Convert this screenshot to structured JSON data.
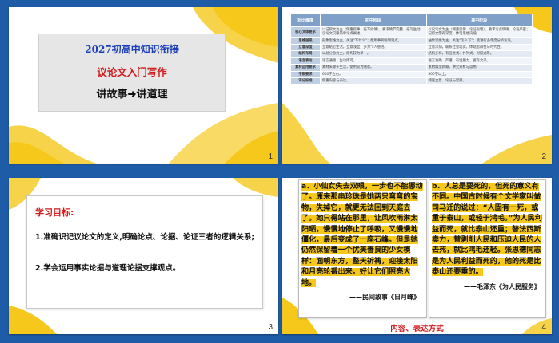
{
  "slide1": {
    "number": "1",
    "line1": "2027初高中知识衔接",
    "line2": "议论文入门写作",
    "line3": "讲故事➜讲道理"
  },
  "slide2": {
    "number": "2",
    "headers": [
      "对比维度",
      "初中阶段",
      "高中阶段"
    ],
    "rows": [
      {
        "label": "核心文体要求",
        "a": "以记叙文为主（侧重叙事、描写抒情），要求情节完整、描写生动，议论文仅限简单论点阐述。",
        "b": "以议论文为主（侧重思辨、论证说理），要求论点明确、论证严密；记叙文需有深度、体现思想内涵。"
      },
      {
        "label": "思维层级",
        "a": "形象思维为主，关注“写什么”；能用事例说明观点。",
        "b": "抽象思维为主，关注“怎么写”；能进行多角度分析论证。"
      },
      {
        "label": "立意深度",
        "a": "立意贴近生活，立意浅显，多为个人感悟。",
        "b": "立意深刻，联系社会现实，体现思辨性与时代性。"
      },
      {
        "label": "结构布局",
        "a": "以总分总为主，结构较为单一。",
        "b": "结构多样，有层进式、并列式、对照式等。"
      },
      {
        "label": "语言表达",
        "a": "语言通顺、生动即可。",
        "b": "语言准确、严谨、有说服力，富有文采。"
      },
      {
        "label": "素材运用要求",
        "a": "素材来源于生活，使用较为随意。",
        "b": "素材典型新颖，讲究分析与运用。"
      },
      {
        "label": "字数要求",
        "a": "600字左右。",
        "b": "800字以上。"
      },
      {
        "label": "评分标准",
        "a": "侧重内容与表达。",
        "b": "侧重立意、论证与思辨。"
      }
    ]
  },
  "slide3": {
    "number": "3",
    "title": "学习目标:",
    "point1": "1.准确识记议论文的定义,明确论点、论据、论证三者的逻辑关系;",
    "point2": "2.学会运用事实论据与道理论据支撑观点。"
  },
  "slide4": {
    "number": "4",
    "left_text_plain": "a．小仙女失去双眼，一步也不能挪动了。原来那串珍珠是她两只弯弯的宝物，失掉它，就更无法回到天庭去了。她只得站在那里，让风吹雨淋太阳晒，慢慢地停止了呼吸，又慢慢地僵化，最后变成了一座石峰。但是她仍然保留着一个优美善良的少女模样：面朝东方，整天祈祷，迎接太阳和月亮轮番出来，好让它们照亮大地。",
    "left_cite": "——民间故事《日月峰》",
    "right_text": "b．人总是要死的，但死的意义有不同。中国古时候有个文学家叫做司马迁的说过：“人固有一死，或重于泰山，或轻于鸿毛。”为人民利益而死，就比泰山还重；替法西斯卖力，替剥削人民和压迫人民的人去死，就比鸿毛还轻。张思德同志是为人民利益而死的，他的死是比泰山还要重的。",
    "right_cite": "——毛泽东《为人民服务》",
    "footer": "内容、表达方式"
  },
  "colors": {
    "background": "#1f5ca8",
    "accent_yellow": "#f5c81b",
    "title_blue": "#1a3fb8",
    "title_red": "#d11a1a"
  }
}
